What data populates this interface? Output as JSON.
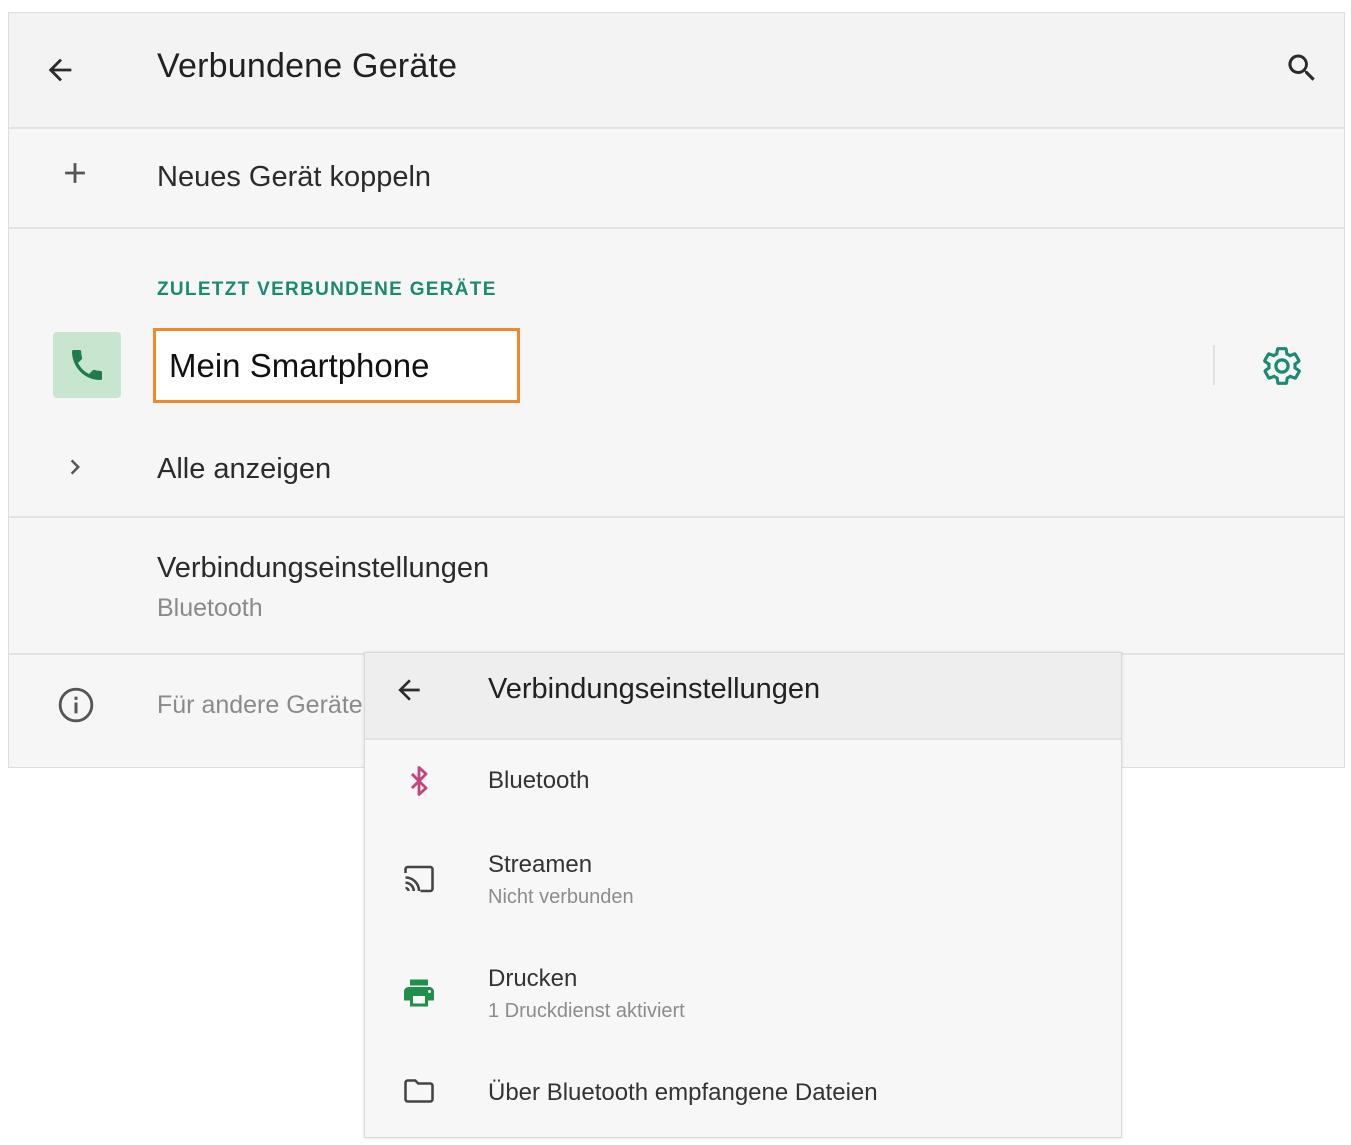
{
  "header": {
    "title": "Verbundene Geräte",
    "back_icon": "arrow-left-icon",
    "search_icon": "search-icon"
  },
  "pair_new": {
    "label": "Neues Gerät koppeln",
    "icon": "plus-icon"
  },
  "recent": {
    "section_title": "ZULETZT VERBUNDENE GERÄTE",
    "device": {
      "name": "Mein Smartphone",
      "icon": "phone-icon",
      "settings_icon": "gear-icon"
    },
    "show_all": {
      "label": "Alle anzeigen",
      "icon": "chevron-right-icon"
    }
  },
  "connection_settings": {
    "label": "Verbindungseinstellungen",
    "sublabel": "Bluetooth"
  },
  "info": {
    "label": "Für andere Geräte",
    "icon": "info-icon"
  },
  "panel": {
    "title": "Verbindungseinstellungen",
    "items": [
      {
        "label": "Bluetooth",
        "sublabel": "",
        "icon": "bluetooth-icon"
      },
      {
        "label": "Streamen",
        "sublabel": "Nicht verbunden",
        "icon": "cast-icon"
      },
      {
        "label": "Drucken",
        "sublabel": "1 Druckdienst aktiviert",
        "icon": "printer-icon"
      },
      {
        "label": "Über Bluetooth empfangene Dateien",
        "sublabel": "",
        "icon": "folder-icon"
      }
    ]
  },
  "colors": {
    "accent_green": "#1a8a73",
    "highlight_orange": "#ee8a2c",
    "phone_tile": "#c8e6cf",
    "bluetooth_pink": "#c2457f",
    "printer_green": "#1f8f4a"
  }
}
